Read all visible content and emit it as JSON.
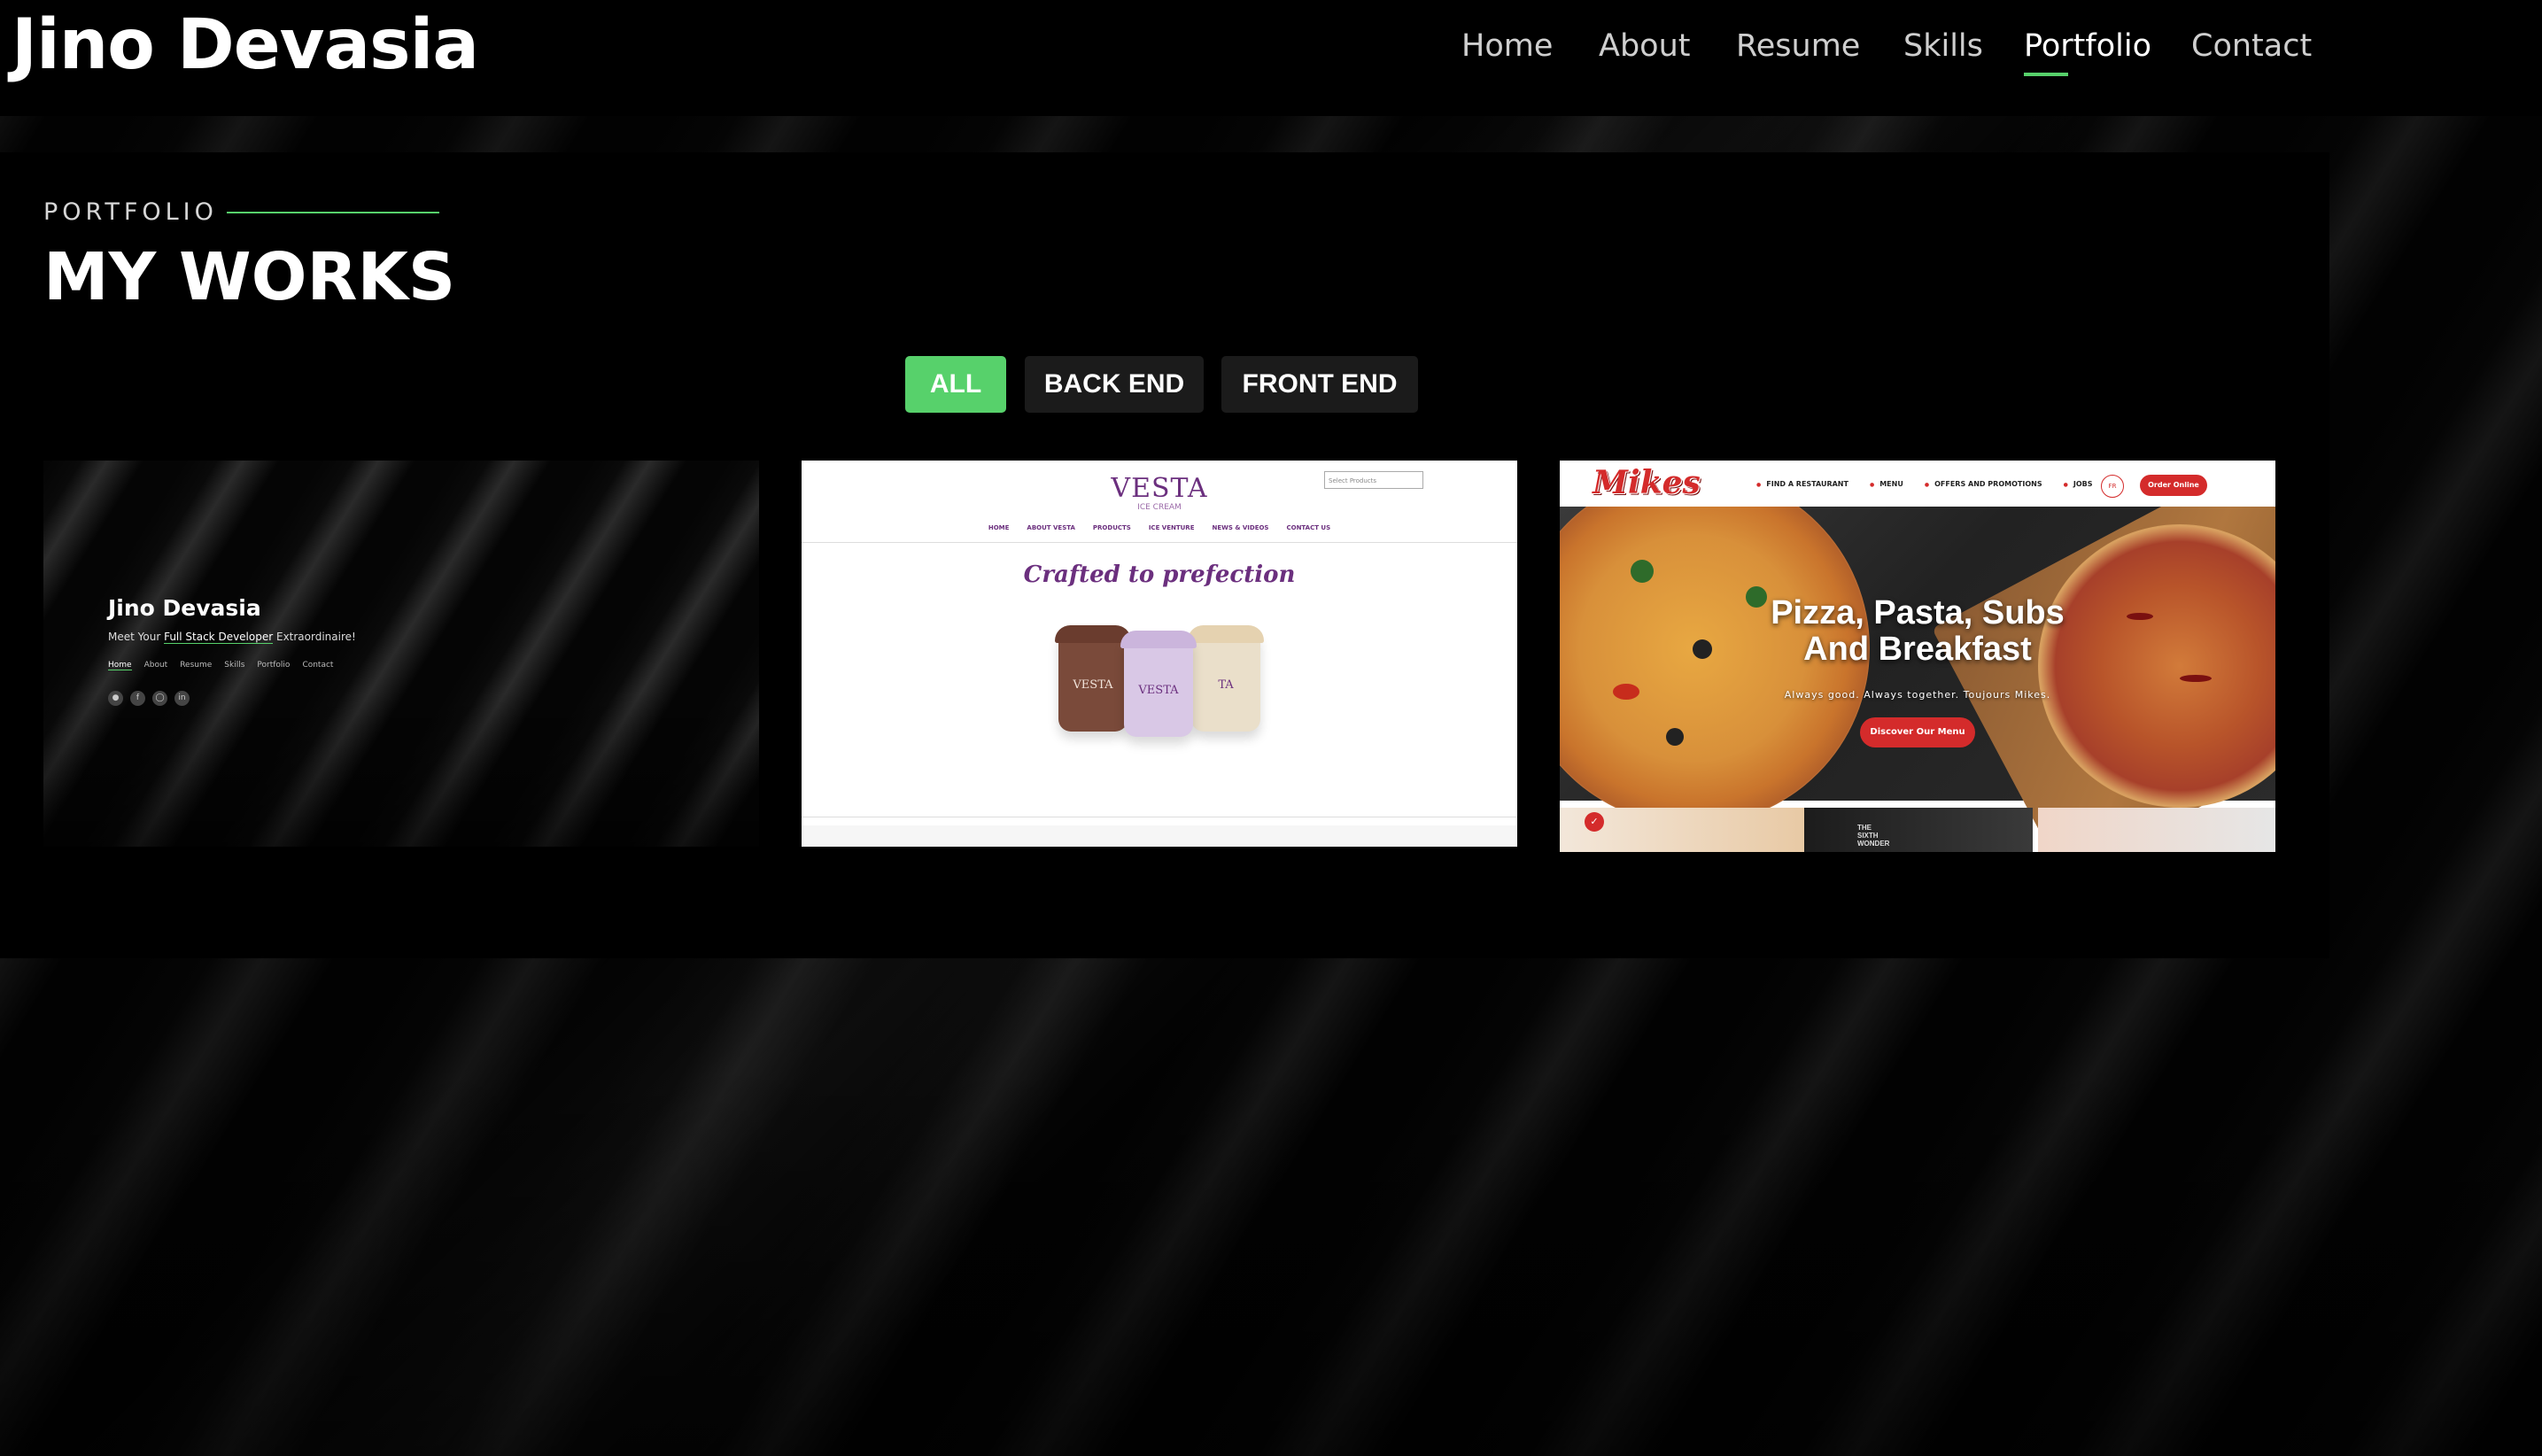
{
  "header": {
    "logo": "Jino Devasia",
    "nav": [
      {
        "label": "Home",
        "active": false
      },
      {
        "label": "About",
        "active": false
      },
      {
        "label": "Resume",
        "active": false
      },
      {
        "label": "Skills",
        "active": false
      },
      {
        "label": "Portfolio",
        "active": true
      },
      {
        "label": "Contact",
        "active": false
      }
    ]
  },
  "section": {
    "eyebrow": "PORTFOLIO",
    "title": "MY WORKS"
  },
  "filters": [
    {
      "label": "ALL",
      "active": true
    },
    {
      "label": "BACK END",
      "active": false
    },
    {
      "label": "FRONT END",
      "active": false
    }
  ],
  "projects": {
    "portfolio": {
      "name": "Jino Devasia",
      "tagline_pre": "Meet Your ",
      "tagline_em": "Full Stack Developer",
      "tagline_post": " Extraordinaire!",
      "nav": [
        "Home",
        "About",
        "Resume",
        "Skills",
        "Portfolio",
        "Contact"
      ],
      "social_icons": [
        "github-icon",
        "facebook-icon",
        "instagram-icon",
        "linkedin-icon"
      ]
    },
    "vesta": {
      "logo": "VESTA",
      "logo_sub": "ICE CREAM",
      "search_placeholder": "Select Products",
      "menu": [
        "HOME",
        "ABOUT VESTA",
        "PRODUCTS",
        "ICE VENTURE",
        "NEWS & VIDEOS",
        "CONTACT US"
      ],
      "heading": "Crafted to prefection",
      "cup_labels": [
        "VESTA",
        "VESTA",
        "TA"
      ],
      "cup_colors": [
        "#7a4a3a",
        "#d9c8e6",
        "#eadfca"
      ]
    },
    "mikes": {
      "logo": "Mikes",
      "menu": [
        "FIND A RESTAURANT",
        "MENU",
        "OFFERS AND PROMOTIONS",
        "JOBS"
      ],
      "lang": "FR",
      "order_button": "Order Online",
      "hero_title_line1": "Pizza, Pasta, Subs",
      "hero_title_line2": "And Breakfast",
      "hero_subtitle": "Always good. Always together. Toujours Mikes.",
      "cta": "Discover Our Menu",
      "thumb_text": "THE SIXTH WONDER"
    }
  },
  "colors": {
    "accent": "#57d16b",
    "background": "#000000",
    "filter_inactive": "#1b1b1b",
    "mikes_red": "#d42b2b",
    "vesta_purple": "#6b2f7e"
  }
}
